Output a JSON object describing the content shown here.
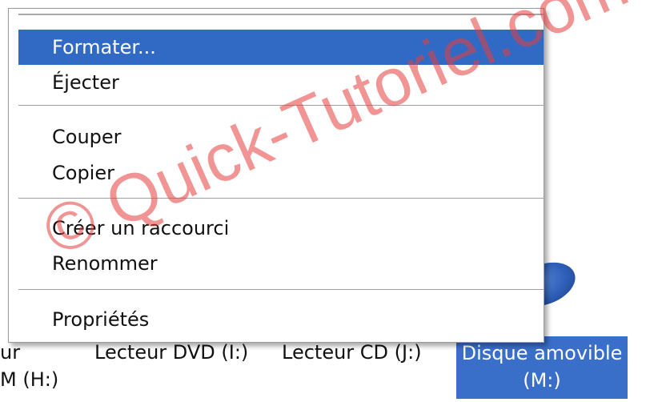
{
  "context_menu": {
    "items": [
      {
        "label": "Formater...",
        "highlighted": true
      },
      {
        "label": "Éjecter"
      },
      {
        "label": "Couper"
      },
      {
        "label": "Copier"
      },
      {
        "label": "Créer un raccourci"
      },
      {
        "label": "Renommer"
      },
      {
        "label": "Propriétés"
      }
    ]
  },
  "explorer": {
    "labels": [
      "ur",
      "Lecteur DVD (I:)",
      "Lecteur CD (J:)",
      "M (H:)"
    ],
    "selected_drive": "Disque amovible (M:)",
    "selected_drive_icon": "removable-disk-icon"
  },
  "watermark": "© Quick-Tutoriel.com",
  "colors": {
    "highlight": "#316ac5",
    "watermark": "#e63c3c"
  }
}
